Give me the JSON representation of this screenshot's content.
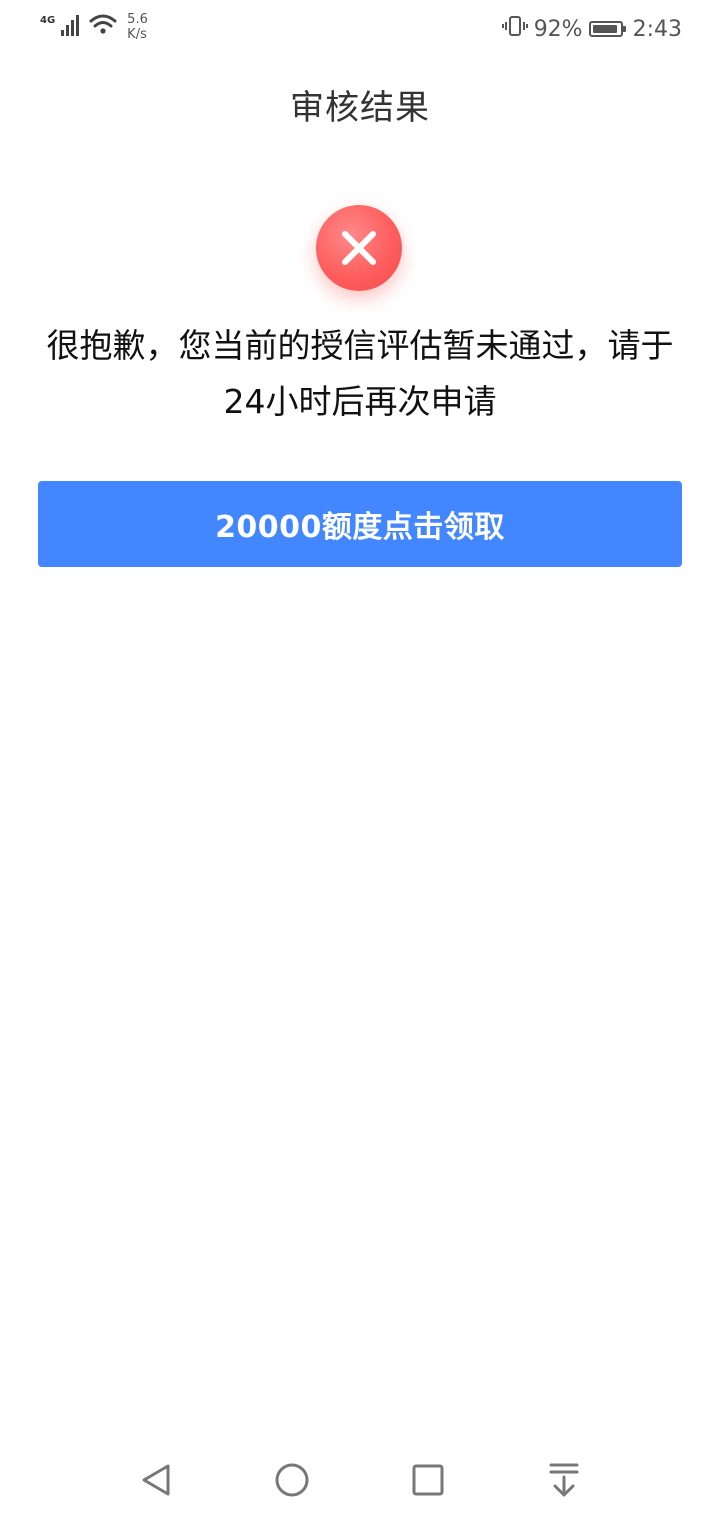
{
  "status_bar": {
    "network_label": "4G",
    "speed_value": "5.6",
    "speed_unit": "K/s",
    "battery_percent": "92%",
    "battery_level": 0.92,
    "time": "2:43"
  },
  "header": {
    "title": "审核结果"
  },
  "result": {
    "icon": "close-icon",
    "message": "很抱歉，您当前的授信评估暂未通过，请于24小时后再次申请"
  },
  "action": {
    "button_label": "20000额度点击领取"
  },
  "nav_bar": {
    "icons": [
      "back-icon",
      "home-icon",
      "recents-icon",
      "notification-pulldown-icon"
    ]
  },
  "colors": {
    "accent": "#4287ff",
    "error": "#ff5e5e"
  }
}
